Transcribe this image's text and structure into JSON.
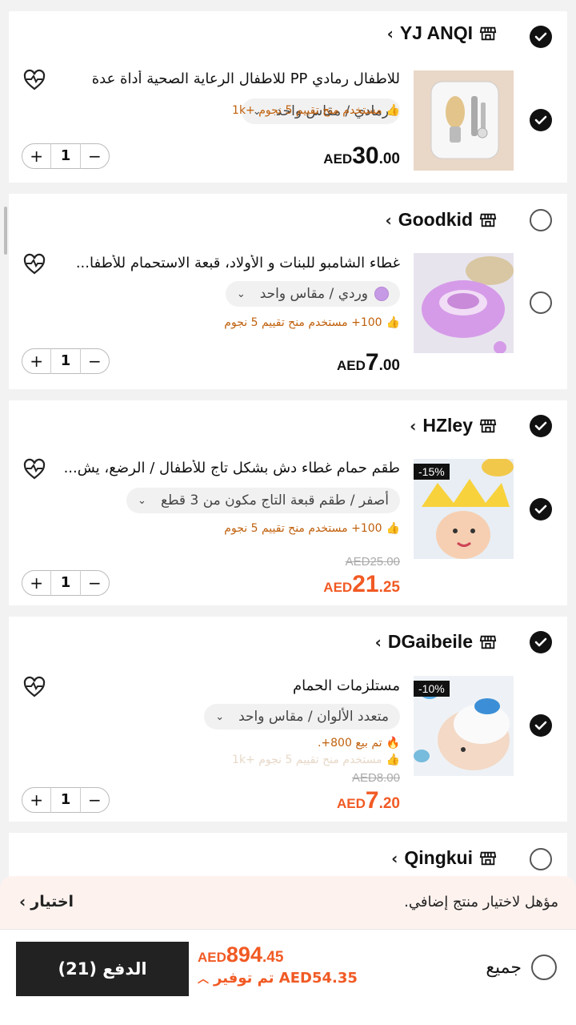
{
  "stores": [
    {
      "name": "YJ ANQI",
      "selected": true,
      "item": {
        "selected": true,
        "title": "للاطفال رمادي PP للاطفال الرعاية الصحية أداة عدة",
        "variant": "رمادي / مقاس واحد",
        "social": "مستخدم منح تقييم 5 نجوم +1k",
        "price_currency": "AED",
        "price_int": "30",
        "price_dec": ".00",
        "quantity": "1"
      }
    },
    {
      "name": "Goodkid",
      "selected": false,
      "item": {
        "selected": false,
        "title": "غطاء الشامبو للبنات و الأولاد، قبعة الاستحمام للأطفا...",
        "variant": "وردي / مقاس واحد",
        "social": "100+ مستخدم منح تقييم 5 نجوم",
        "price_currency": "AED",
        "price_int": "7",
        "price_dec": ".00",
        "quantity": "1"
      }
    },
    {
      "name": "HZley",
      "selected": true,
      "item": {
        "selected": true,
        "discount_badge": "-15%",
        "title": "طقم حمام غطاء دش بشكل تاج للأطفال / الرضع، يش...",
        "variant": "أصفر / طقم قبعة التاج مكون من 3 قطع",
        "social": "100+ مستخدم منح تقييم 5 نجوم",
        "original_price": "AED25.00",
        "price_currency": "AED",
        "price_int": "21",
        "price_dec": ".25",
        "quantity": "1"
      }
    },
    {
      "name": "DGaibeile",
      "selected": true,
      "item": {
        "selected": true,
        "discount_badge": "-10%",
        "title": "مستلزمات الحمام",
        "variant": "متعدد الألوان / مقاس واحد",
        "sold": "تم بيع 800+.",
        "social_faded": "مستخدم منح تقييم 5 نجوم +1k",
        "original_price": "AED8.00",
        "price_currency": "AED",
        "price_int": "7",
        "price_dec": ".20",
        "quantity": "1"
      }
    },
    {
      "name": "Qingkui",
      "selected": false
    }
  ],
  "promo": {
    "text": "مؤهل لاختيار منتج إضافي.",
    "action": "اختيار"
  },
  "footer": {
    "select_all": "جميع",
    "total_currency": "AED",
    "total_int": "894",
    "total_dec": ".45",
    "savings": "تم توفير AED54.35",
    "pay_button": "الدفع (21)"
  },
  "colors": {
    "accent_orange": "#f15a24",
    "social_orange": "#c0600c",
    "dark": "#222222"
  }
}
